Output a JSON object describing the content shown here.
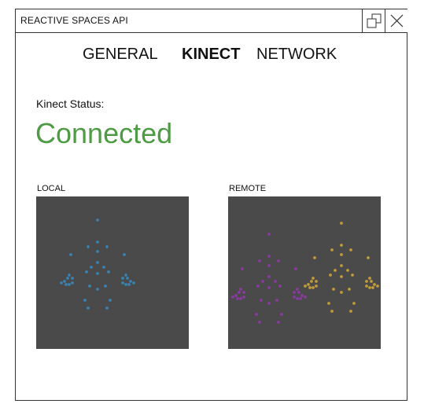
{
  "window": {
    "title": "REACTIVE SPACES API"
  },
  "titlebar": {
    "restore_icon": "restore-icon",
    "close_icon": "close-icon"
  },
  "tabs": [
    {
      "label": "GENERAL",
      "active": false
    },
    {
      "label": "KINECT",
      "active": true
    },
    {
      "label": "NETWORK",
      "active": false
    }
  ],
  "status": {
    "label": "Kinect Status:",
    "value": "Connected",
    "color": "#4e9a45"
  },
  "local": {
    "label": "LOCAL",
    "dot_color": "#3a82b0",
    "background": "#4a4a4a"
  },
  "remote": {
    "label": "REMOTE",
    "colors": [
      "#8a3aa0",
      "#c19a3a"
    ],
    "background": "#4a4a4a"
  }
}
